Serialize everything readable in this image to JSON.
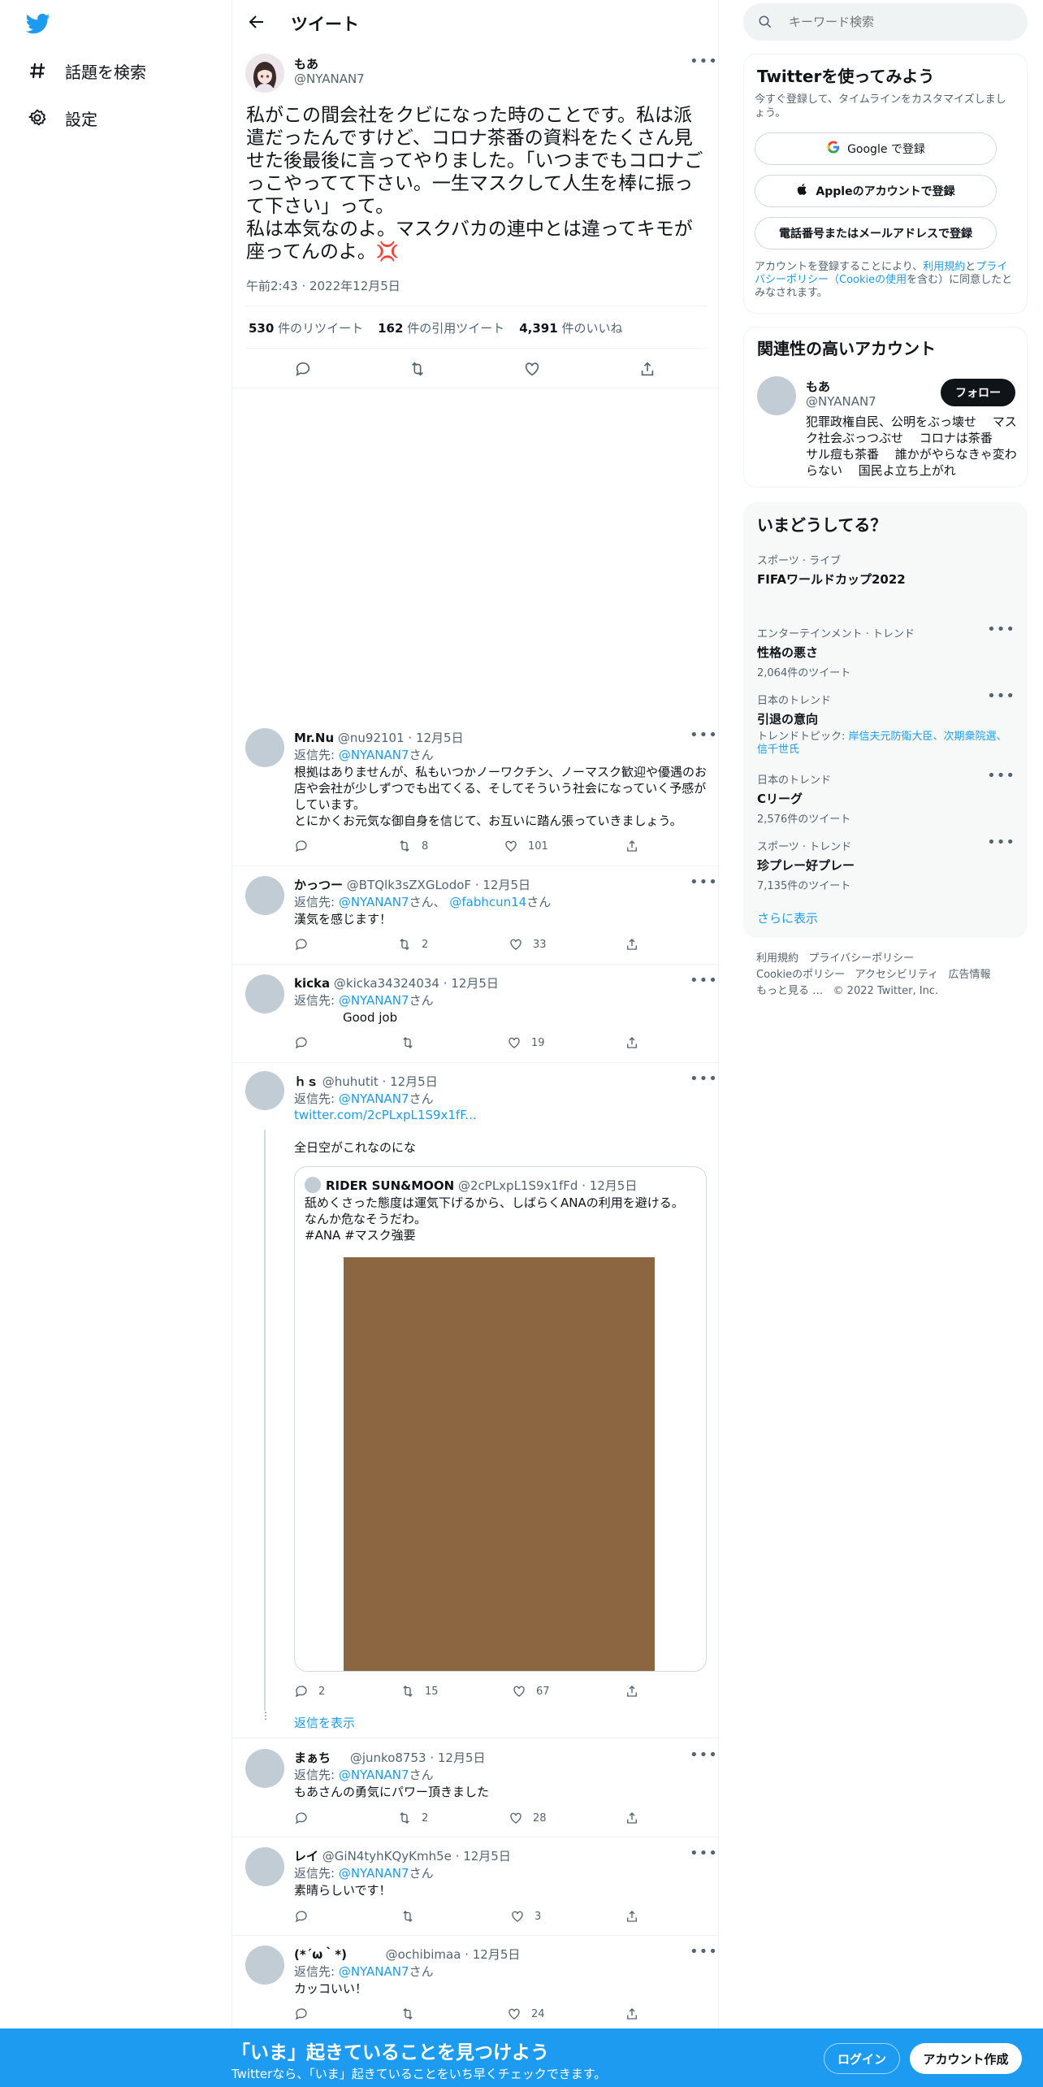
{
  "nav": {
    "explore_label": "話題を検索",
    "settings_label": "設定"
  },
  "header": {
    "title": "ツイート"
  },
  "tweet": {
    "author_name": "もあ",
    "author_handle": "@NYANAN7",
    "text": "私がこの間会社をクビになった時のことです。私は派遣だったんですけど、コロナ茶番の資料をたくさん見せた後最後に言ってやりました。「いつまでもコロナごっこやってて下さい。一生マスクして人生を棒に振って下さい」って。\n私は本気なのよ。マスクバカの連中とは違ってキモが座ってんのよ。💢",
    "time": "午前2:43 · 2022年12月5日",
    "retweets_count": "530",
    "retweets_label": "件のリツイート",
    "quotes_count": "162",
    "quotes_label": "件の引用ツイート",
    "likes_count": "4,391",
    "likes_label": "件のいいね"
  },
  "replies": [
    {
      "name": "Mr.Nu",
      "handle": "@nu92101",
      "date": "· 12月5日",
      "reply_prefix": "返信先: ",
      "reply_to": "@NYANAN7",
      "reply_suffix": "さん",
      "text": "根拠はありませんが、私もいつかノーワクチン、ノーマスク歓迎や優遇のお店や会社が少しずつでも出てくる、そしてそういう社会になっていく予感がしています。\nとにかくお元気な御自身を信じて、お互いに踏ん張っていきましょう。",
      "retweets": "8",
      "likes": "101"
    },
    {
      "name": "かっつー",
      "handle": "@BTQlk3sZXGLodoF",
      "date": "· 12月5日",
      "reply_prefix": "返信先: ",
      "reply_to": "@NYANAN7",
      "reply_mid": "さん、",
      "reply_to2": "@fabhcun14",
      "reply_suffix": "さん",
      "text": "漢気を感じます！",
      "retweets": "2",
      "likes": "33"
    },
    {
      "name": "kicka",
      "handle": "@kicka34324034",
      "date": "· 12月5日",
      "reply_prefix": "返信先: ",
      "reply_to": "@NYANAN7",
      "reply_suffix": "さん",
      "text": "Good job",
      "retweets": "",
      "likes": "19"
    },
    {
      "name": "ｈｓ",
      "handle": "@huhutit",
      "date": "· 12月5日",
      "reply_prefix": "返信先: ",
      "reply_to": "@NYANAN7",
      "reply_suffix": "さん",
      "link": "twitter.com/2cPLxpL1S9x1fF...",
      "text": "全日空がこれなのにな",
      "quote_name": "RIDER SUN&MOON",
      "quote_handle": "@2cPLxpL1S9x1fFd",
      "quote_date": "· 12月5日",
      "quote_text": "舐めくさった態度は運気下げるから、しばらくANAの利用を避ける。\nなんか危なそうだわ。\n#ANA #マスク強要",
      "replies": "2",
      "retweets": "15",
      "likes": "67",
      "show_replies": "返信を表示"
    },
    {
      "name": "まぁち",
      "handle": "@junko8753",
      "date": "· 12月5日",
      "reply_prefix": "返信先: ",
      "reply_to": "@NYANAN7",
      "reply_suffix": "さん",
      "text": "もあさんの勇気にパワー頂きました",
      "retweets": "2",
      "likes": "28"
    },
    {
      "name": "レイ",
      "handle": "@GiN4tyhKQyKmh5e",
      "date": "· 12月5日",
      "reply_prefix": "返信先: ",
      "reply_to": "@NYANAN7",
      "reply_suffix": "さん",
      "text": "素晴らしいです！",
      "retweets": "",
      "likes": "3"
    },
    {
      "name": "(*´ω｀*)",
      "handle": "@ochibimaa",
      "date": "· 12月5日",
      "reply_prefix": "返信先: ",
      "reply_to": "@NYANAN7",
      "reply_suffix": "さん",
      "text": "カッコいい！",
      "retweets": "",
      "likes": "24"
    }
  ],
  "search": {
    "placeholder": "キーワード検索"
  },
  "signup": {
    "title": "Twitterを使ってみよう",
    "subtitle": "今すぐ登録して、タイムラインをカスタマイズしましょう。",
    "google": "Google で登録",
    "apple": "Appleのアカウントで登録",
    "phone": "電話番号またはメールアドレスで登録",
    "terms_1": "アカウントを登録することにより、",
    "terms_link1": "利用規約",
    "terms_2": "と",
    "terms_link2": "プライバシーポリシー（Cookieの使用",
    "terms_3": "を含む）に同意したとみなされます。"
  },
  "relevant": {
    "title": "関連性の高いアカウント",
    "name": "もあ",
    "handle": "@NYANAN7",
    "follow": "フォロー",
    "bio": "犯罪政権自民、公明をぶっ壊せ　 マスク社会ぶっつぶせ　 コロナは茶番　 サル痘も茶番　 誰かがやらなきゃ変わらない　 国民よ立ち上がれ"
  },
  "trends": {
    "title": "いまどうしてる？",
    "items": [
      {
        "category": "スポーツ · ライブ",
        "name": "FIFAワールドカップ2022",
        "count": ""
      },
      {
        "category": "エンターテインメント · トレンド",
        "name": "性格の悪さ",
        "count": "2,064件のツイート"
      },
      {
        "category": "日本のトレンド",
        "name": "引退の意向",
        "count": "",
        "topic_label": "トレンドトピック: ",
        "topic": "岸信夫元防衛大臣、次期衆院選、信千世氏"
      },
      {
        "category": "日本のトレンド",
        "name": "Cリーグ",
        "count": "2,576件のツイート"
      },
      {
        "category": "スポーツ · トレンド",
        "name": "珍プレー好プレー",
        "count": "7,135件のツイート"
      }
    ],
    "show_more": "さらに表示"
  },
  "footer": {
    "terms": "利用規約",
    "privacy": "プライバシーポリシー",
    "cookie": "Cookieのポリシー",
    "accessibility": "アクセシビリティ",
    "ads": "広告情報",
    "more": "もっと見る …",
    "copyright": "© 2022 Twitter, Inc."
  },
  "bottom_bar": {
    "title": "「いま」起きていることを見つけよう",
    "subtitle": "Twitterなら、「いま」起きていることをいち早くチェックできます。",
    "login": "ログイン",
    "signup": "アカウント作成"
  },
  "colors": {
    "brand_blue": "#1d9bf0",
    "text": "#0f1419",
    "muted": "#536471",
    "quote_image": "#8b6640"
  }
}
